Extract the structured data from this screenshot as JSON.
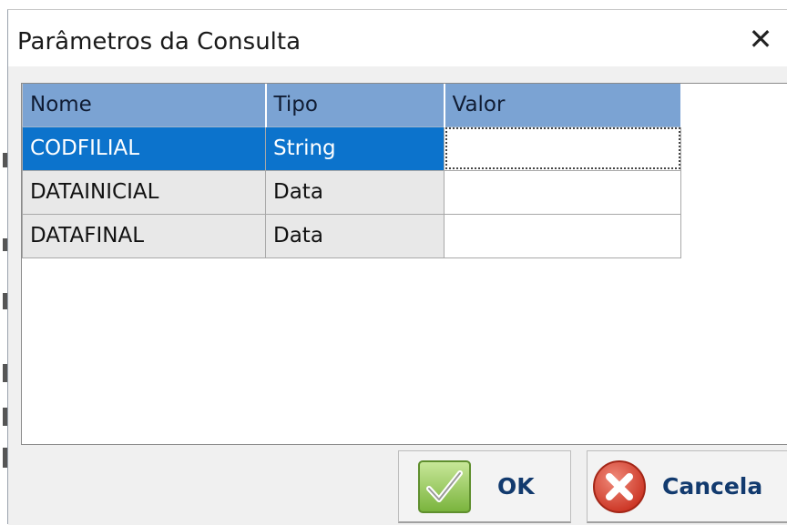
{
  "window": {
    "title": "Parâmetros da Consulta",
    "close_glyph": "✕"
  },
  "grid": {
    "columns": [
      "Nome",
      "Tipo",
      "Valor"
    ],
    "rows": [
      {
        "nome": "CODFILIAL",
        "tipo": "String",
        "valor": "",
        "selected": true
      },
      {
        "nome": "DATAINICIAL",
        "tipo": "Data",
        "valor": "",
        "selected": false
      },
      {
        "nome": "DATAFINAL",
        "tipo": "Data",
        "valor": "",
        "selected": false
      }
    ]
  },
  "buttons": {
    "ok": {
      "label": "OK",
      "icon": "checkmark-icon"
    },
    "cancel": {
      "label": "Cancela",
      "icon": "cancel-x-icon"
    }
  },
  "colors": {
    "header": "#7ba3d3",
    "selection": "#0c73cc",
    "button_text": "#123a6e"
  }
}
